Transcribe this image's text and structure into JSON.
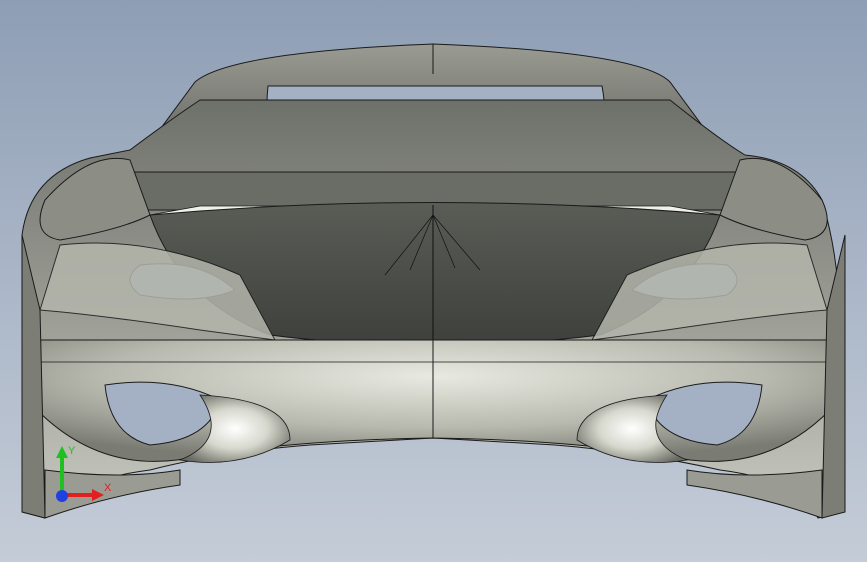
{
  "viewport": {
    "background_top": "#8e9eb4",
    "background_bottom": "#c4ccd7",
    "model": {
      "description_icon": "car-front-surface-model",
      "surface_dark": "#4a4c48",
      "surface_mid": "#8a8c84",
      "surface_light": "#dfe0d6",
      "edge_color": "#1a1a1a"
    },
    "triad": {
      "x_label": "X",
      "y_label": "Y",
      "x_color": "#e02020",
      "y_color": "#20c020",
      "z_color": "#2040e0"
    }
  }
}
